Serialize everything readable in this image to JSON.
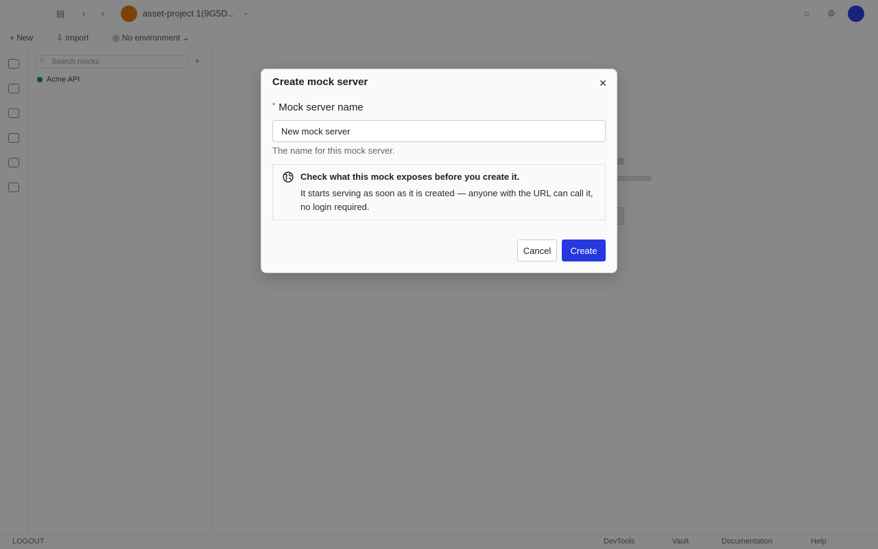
{
  "app": {
    "topbar": {
      "workspace_name": "asset-project 1(9G5D...",
      "icons": [
        "sidebar-toggle-icon",
        "back-icon",
        "forward-icon",
        "chevron-down-icon",
        "notifications-icon",
        "settings-icon"
      ]
    },
    "toolbar": {
      "new_label": "New",
      "import_label": "Import",
      "environment_label": "No environment"
    },
    "sidebar": {
      "search_placeholder": "Search mocks",
      "items": [
        {
          "label": "Acme API",
          "status_color": "#1c8f4e"
        }
      ]
    },
    "statusbar": {
      "left_label": "LOGOUT",
      "items": [
        "DevTools",
        "Vault",
        "Documentation",
        "Help"
      ]
    }
  },
  "dialog": {
    "title": "Create mock server",
    "close_icon": "close-icon",
    "field_label": "Mock server name",
    "required_marker": "*",
    "input_value": "New mock server",
    "help_text": "The name for this mock server.",
    "notice": {
      "icon": "globe-icon",
      "title": "Check what this mock exposes before you create it.",
      "body": "It starts serving as soon as it is created — anyone with the URL can call it, no login required."
    },
    "cancel_label": "Cancel",
    "create_label": "Create"
  },
  "colors": {
    "primary": "#2638df",
    "required": "#d92d20",
    "workspace_avatar": "#e07a12",
    "user_avatar": "#2c3fe0",
    "overlay": "rgba(0,0,0,0.45)"
  }
}
